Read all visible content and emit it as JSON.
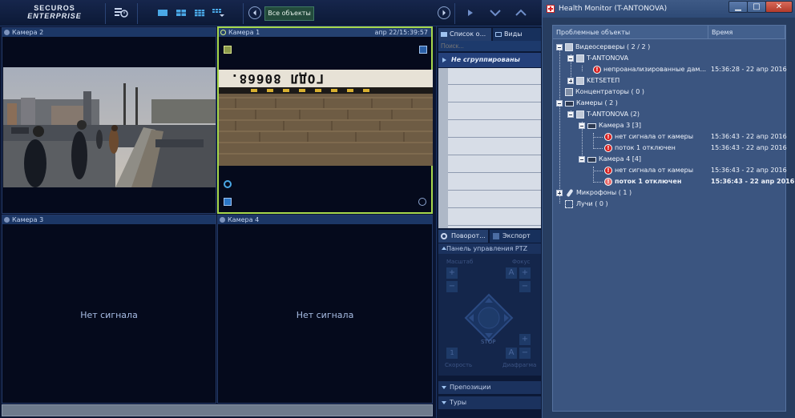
{
  "topbar": {
    "logo_line1": "SECUROS",
    "logo_line2": "ENTERPRISE",
    "all_objects_label": "Все объекты"
  },
  "cameras": [
    {
      "title": "Камера 2"
    },
    {
      "title": "Камера 1",
      "timestamp": "апр 22/15:39:57",
      "overlay_text": "ГОДЛ 80668."
    },
    {
      "title": "Камера 3",
      "status": "Нет сигнала"
    },
    {
      "title": "Камера 4",
      "status": "Нет сигнала"
    }
  ],
  "objects_panel": {
    "tab_list": "Список о...",
    "tab_views": "Виды",
    "search_placeholder": "Поиск...",
    "group_label": "Не сгруппированы",
    "tab_rotate": "Поворот...",
    "tab_export": "Экспорт",
    "ptz_title": "Панель управления PTZ",
    "ptz_zoom_label": "Масштаб",
    "ptz_focus_label": "Фокус",
    "ptz_aperture_label": "Диафрагма",
    "ptz_speed_label": "Скорость",
    "ptz_stop": "STOP",
    "ptz_auto": "A",
    "ptz_speed_value": "1",
    "presets_label": "Препозиции",
    "tours_label": "Туры"
  },
  "health_monitor": {
    "title": "Health Monitor (T-ANTONOVA)",
    "col_objects": "Проблемные объекты",
    "col_time": "Время",
    "tree": [
      {
        "label": "Видеосерверы ( 2 / 2 )",
        "time": ""
      },
      {
        "label": "T-ANTONOVA",
        "time": ""
      },
      {
        "label": "непроанализированные дам...",
        "time": "15:36:28 - 22 апр 2016"
      },
      {
        "label": "KETSETEП",
        "time": ""
      },
      {
        "label": "Концентраторы ( 0 )",
        "time": ""
      },
      {
        "label": "Камеры ( 2 )",
        "time": ""
      },
      {
        "label": "T-ANTONOVA (2)",
        "time": ""
      },
      {
        "label": "Камера 3 [3]",
        "time": ""
      },
      {
        "label": "нет сигнала от камеры",
        "time": "15:36:43 - 22 апр 2016"
      },
      {
        "label": "поток 1 отключен",
        "time": "15:36:43 - 22 апр 2016"
      },
      {
        "label": "Камера 4 [4]",
        "time": ""
      },
      {
        "label": "нет сигнала от камеры",
        "time": "15:36:43 - 22 апр 2016"
      },
      {
        "label": "поток 1 отключен",
        "time": "15:36:43 - 22 апр 2016"
      },
      {
        "label": "Микрофоны ( 1 )",
        "time": ""
      },
      {
        "label": "Лучи ( 0 )",
        "time": ""
      }
    ]
  },
  "colors": {
    "accent_active_camera": "#a7d84c",
    "error": "#d62020",
    "app_background": "#0b1530"
  }
}
